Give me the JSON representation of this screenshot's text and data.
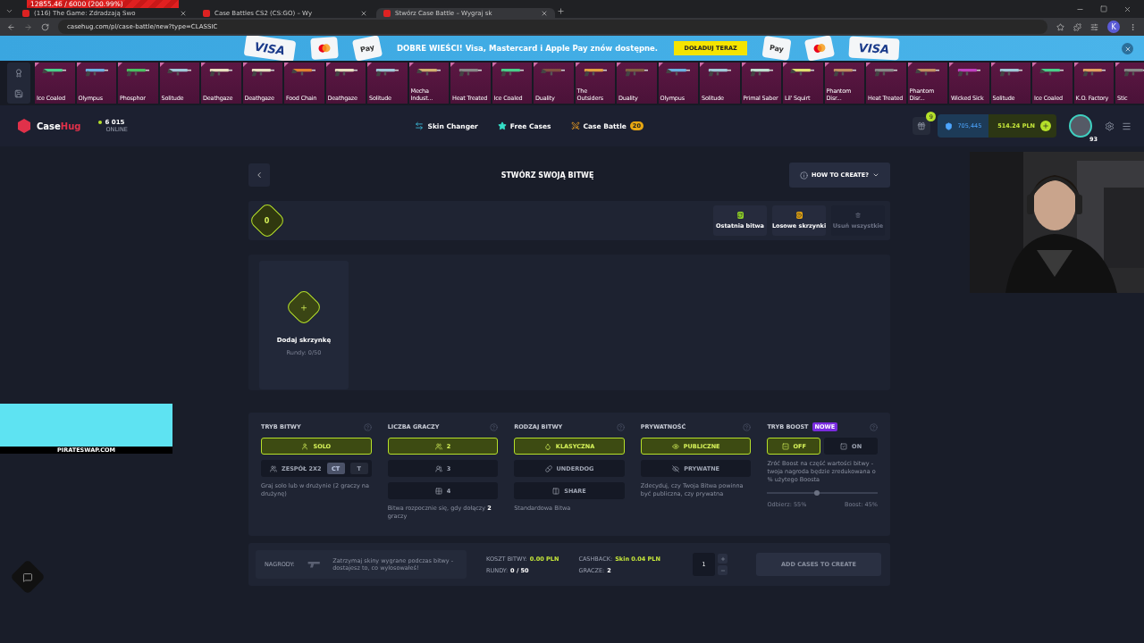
{
  "stream_overlay": {
    "counter": "12855.46 / 6000 (200.99%)",
    "promo": "PIRATESWAP.COM"
  },
  "browser": {
    "tabs": [
      {
        "title": "(116) The Game: Zdradzają Swo",
        "selected": false
      },
      {
        "title": "Case Battles CS2 (CS:GO) – Wy",
        "selected": false
      },
      {
        "title": "Stwórz Case Battle – Wygraj sk",
        "selected": true
      }
    ],
    "url": "casehug.com/pl/case-battle/new?type=CLASSIC",
    "profile": "K"
  },
  "banner": {
    "text": "DOBRE WIEŚCI! Visa, Mastercard i Apple Pay znów dostępne.",
    "button": "DOŁADUJ TERAZ",
    "cards_left": [
      {
        "kind": "visa",
        "text": "VISA"
      },
      {
        "kind": "mastercard"
      },
      {
        "kind": "applepay",
        "text": "Pay"
      }
    ],
    "cards_right": [
      {
        "kind": "applepay",
        "text": "Pay"
      },
      {
        "kind": "mastercard"
      },
      {
        "kind": "visa",
        "text": "VISA"
      }
    ]
  },
  "skins": [
    "Ice Coaled",
    "Olympus",
    "Phosphor",
    "Solitude",
    "Deathgaze",
    "Deathgaze",
    "Food Chain",
    "Deathgaze",
    "Solitude",
    "Mecha Indust...",
    "Heat Treated",
    "Ice Coaled",
    "Duality",
    "The Outsiders",
    "Duality",
    "Olympus",
    "Solitude",
    "Primal Saber",
    "Lil' Squirt",
    "Phantom Disr...",
    "Heat Treated",
    "Phantom Disr...",
    "Wicked Sick",
    "Solitude",
    "Ice Coaled",
    "K.O. Factory",
    "Stic"
  ],
  "header": {
    "logo": {
      "part_1": "Case",
      "part_2": "Hug"
    },
    "online_count": "6 015",
    "online_label": "ONLINE",
    "nav": [
      {
        "label": "Skin Changer"
      },
      {
        "label": "Free Cases"
      },
      {
        "label": "Case Battle",
        "badge": "20"
      }
    ],
    "gift_badge": "9",
    "coins": "705,445",
    "balance": "514.24 PLN",
    "avatar_level": "93"
  },
  "title": "STWÓRZ SWOJĄ BITWĘ",
  "how_to": "HOW TO CREATE?",
  "case_count": "0",
  "actions": [
    {
      "label": "Ostatnia bitwa",
      "disabled": false
    },
    {
      "label": "Losowe skrzynki",
      "disabled": false
    },
    {
      "label": "Usuń wszystkie",
      "disabled": true
    }
  ],
  "add_case": {
    "label": "Dodaj skrzynkę",
    "rounds": "Rundy: 0/50"
  },
  "settings": [
    {
      "kind": "options",
      "title": "TRYB BITWY",
      "options": [
        {
          "label": "SOLO",
          "selected": true
        },
        {
          "label": "ZESPÓŁ 2X2",
          "selected": false,
          "sides": [
            {
              "label": "CT",
              "selected": true
            },
            {
              "label": "T",
              "selected": false
            }
          ]
        }
      ],
      "note": "Graj solo lub w drużynie (2 graczy na drużynę)"
    },
    {
      "kind": "options",
      "title": "LICZBA GRACZY",
      "options": [
        {
          "label": "2",
          "selected": true
        },
        {
          "label": "3",
          "selected": false
        },
        {
          "label": "4",
          "selected": false
        }
      ],
      "note": "Bitwa rozpocznie się, gdy dołączy **2** graczy"
    },
    {
      "kind": "options",
      "title": "RODZAJ BITWY",
      "options": [
        {
          "label": "KLASYCZNA",
          "selected": true
        },
        {
          "label": "UNDERDOG",
          "selected": false
        },
        {
          "label": "SHARE",
          "selected": false
        }
      ],
      "note": "Standardowa Bitwa"
    },
    {
      "kind": "options",
      "title": "PRYWATNOŚĆ",
      "options": [
        {
          "label": "PUBLICZNE",
          "selected": true
        },
        {
          "label": "PRYWATNE",
          "selected": false
        }
      ],
      "note": "Zdecyduj, czy Twoja Bitwa powinna być publiczna, czy prywatna"
    },
    {
      "kind": "boost",
      "title": "TRYB BOOST",
      "badge": "NOWE",
      "options": [
        {
          "label": "OFF",
          "selected": true
        },
        {
          "label": "ON",
          "selected": false
        }
      ],
      "note": "Zróć Boost na część wartości bitwy - twoja nagroda będzie zredukowana o % użytego Boosta",
      "level": 0.45,
      "left_reading": "Odbierz: 55%",
      "right_reading": "Boost: 45%"
    }
  ],
  "footer": {
    "rewards_label": "NAGRODY:",
    "rewards_text": "Zatrzymaj skiny wygrane podczas bitwy - dostajesz to, co wylosowałeś!",
    "cost_label": "KOSZT BITWY:",
    "cost_value": "0.00 PLN",
    "rounds_label": "RUNDY:",
    "rounds_value": "0 / 50",
    "cashback_label": "CASHBACK:",
    "cashback_value": "Skin 0.04 PLN",
    "players_label": "GRACZE:",
    "players_value": "2",
    "quantity": "1",
    "create": "ADD CASES TO CREATE"
  }
}
